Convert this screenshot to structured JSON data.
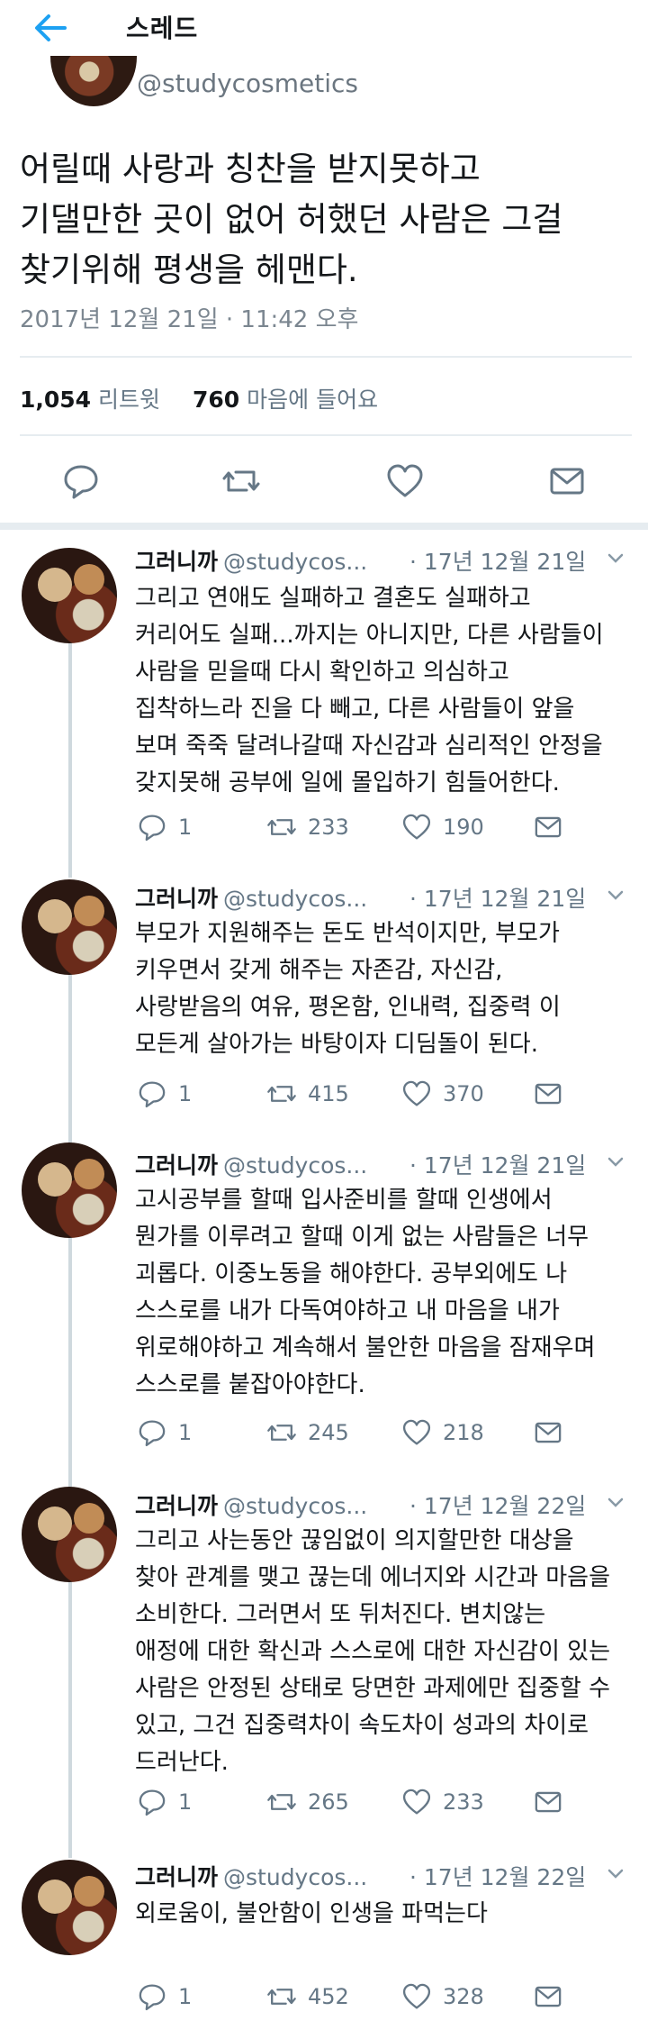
{
  "header": {
    "title": "스레드"
  },
  "main_tweet": {
    "handle": "@studycosmetics",
    "text_lines": [
      "어릴때 사랑과 칭찬을 받지못하고",
      "기댈만한 곳이 없어 허했던 사람은 그걸",
      "찾기위해 평생을 헤맨다."
    ],
    "timestamp": "2017년 12월 21일 · 11:42 오후",
    "retweets": "1,054",
    "retweets_label": "리트윗",
    "likes": "760",
    "likes_label": "마음에 들어요"
  },
  "replies": [
    {
      "name": "그러니까",
      "handle": "@studycos...",
      "date": "· 17년 12월 21일",
      "lines": [
        "그리고 연애도 실패하고 결혼도 실패하고",
        "커리어도 실패...까지는 아니지만, 다른 사람들이",
        "사람을 믿을때 다시 확인하고 의심하고",
        "집착하느라 진을 다 빼고, 다른 사람들이 앞을",
        "보며 죽죽 달려나갈때 자신감과 심리적인 안정을",
        "갖지못해 공부에 일에 몰입하기 힘들어한다."
      ],
      "replies": "1",
      "retweets": "233",
      "likes": "190"
    },
    {
      "name": "그러니까",
      "handle": "@studycos...",
      "date": "· 17년 12월 21일",
      "lines": [
        "부모가 지원해주는 돈도 반석이지만, 부모가",
        "키우면서 갖게 해주는 자존감, 자신감,",
        "사랑받음의 여유, 평온함, 인내력, 집중력 이",
        "모든게 살아가는 바탕이자 디딤돌이 된다."
      ],
      "replies": "1",
      "retweets": "415",
      "likes": "370"
    },
    {
      "name": "그러니까",
      "handle": "@studycos...",
      "date": "· 17년 12월 21일",
      "lines": [
        "고시공부를 할때 입사준비를 할때 인생에서",
        "뭔가를 이루려고 할때 이게 없는 사람들은 너무",
        "괴롭다. 이중노동을 해야한다. 공부외에도 나",
        "스스로를 내가 다독여야하고 내 마음을 내가",
        "위로해야하고 계속해서 불안한 마음을 잠재우며",
        "스스로를 붙잡아야한다."
      ],
      "replies": "1",
      "retweets": "245",
      "likes": "218"
    },
    {
      "name": "그러니까",
      "handle": "@studycos...",
      "date": "· 17년 12월 22일",
      "lines": [
        "그리고 사는동안 끊임없이 의지할만한 대상을",
        "찾아 관계를 맺고 끊는데 에너지와 시간과 마음을",
        "소비한다. 그러면서 또 뒤처진다. 변치않는",
        "애정에 대한 확신과 스스로에 대한 자신감이 있는",
        "사람은 안정된 상태로 당면한 과제에만 집중할 수",
        "있고, 그건 집중력차이 속도차이 성과의 차이로",
        "드러난다."
      ],
      "replies": "1",
      "retweets": "265",
      "likes": "233"
    },
    {
      "name": "그러니까",
      "handle": "@studycos...",
      "date": "· 17년 12월 22일",
      "lines": [
        "외로움이, 불안함이 인생을 파먹는다"
      ],
      "replies": "1",
      "retweets": "452",
      "likes": "328"
    }
  ],
  "colors": {
    "accent": "#1da1f2",
    "muted": "#657786",
    "divider": "#e6ecf0"
  }
}
